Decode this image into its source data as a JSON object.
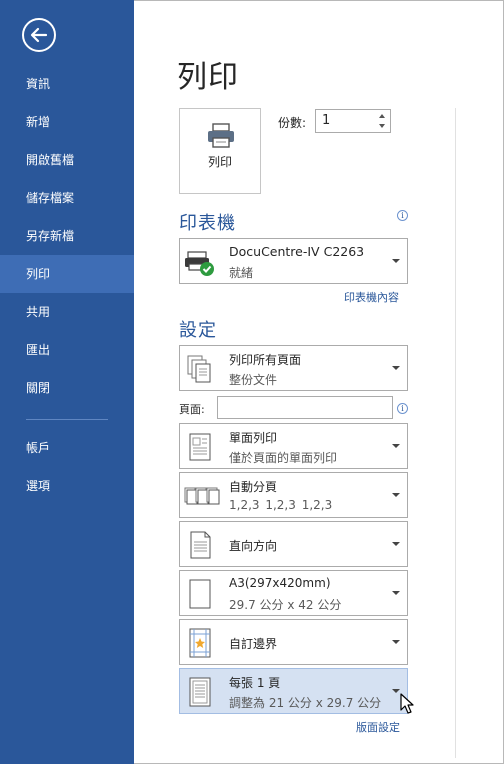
{
  "sidebar": {
    "items": [
      {
        "label": "資訊",
        "active": false
      },
      {
        "label": "新增",
        "active": false
      },
      {
        "label": "開啟舊檔",
        "active": false
      },
      {
        "label": "儲存檔案",
        "active": false
      },
      {
        "label": "另存新檔",
        "active": false
      },
      {
        "label": "列印",
        "active": true
      },
      {
        "label": "共用",
        "active": false
      },
      {
        "label": "匯出",
        "active": false
      },
      {
        "label": "關閉",
        "active": false
      },
      {
        "label": "帳戶",
        "active": false
      },
      {
        "label": "選項",
        "active": false
      }
    ]
  },
  "main": {
    "title": "列印",
    "print_button_label": "列印",
    "copies_label": "份數:",
    "copies_value": "1"
  },
  "printer": {
    "section_title": "印表機",
    "name": "DocuCentre-IV C2263",
    "status": "就緒",
    "properties_link": "印表機內容"
  },
  "settings": {
    "section_title": "設定",
    "pages_label": "頁面:",
    "pages_value": "",
    "options": [
      {
        "title": "列印所有頁面",
        "subtitle": "整份文件"
      },
      {
        "title": "單面列印",
        "subtitle": "僅於頁面的單面列印"
      },
      {
        "title": "自動分頁",
        "subtitle": "1,2,3    1,2,3    1,2,3"
      },
      {
        "title": "直向方向",
        "subtitle": ""
      },
      {
        "title": "A3(297x420mm)",
        "subtitle": "29.7 公分 x 42 公分"
      },
      {
        "title": "自訂邊界",
        "subtitle": ""
      },
      {
        "title": "每張 1 頁",
        "subtitle": "調整為 21 公分 x 29.7 公分"
      }
    ],
    "page_setup_link": "版面設定"
  },
  "colors": {
    "sidebar_bg": "#2a579a",
    "sidebar_active": "#3e6db5",
    "accent": "#2a579a",
    "hover_bg": "#d5e1f2"
  }
}
